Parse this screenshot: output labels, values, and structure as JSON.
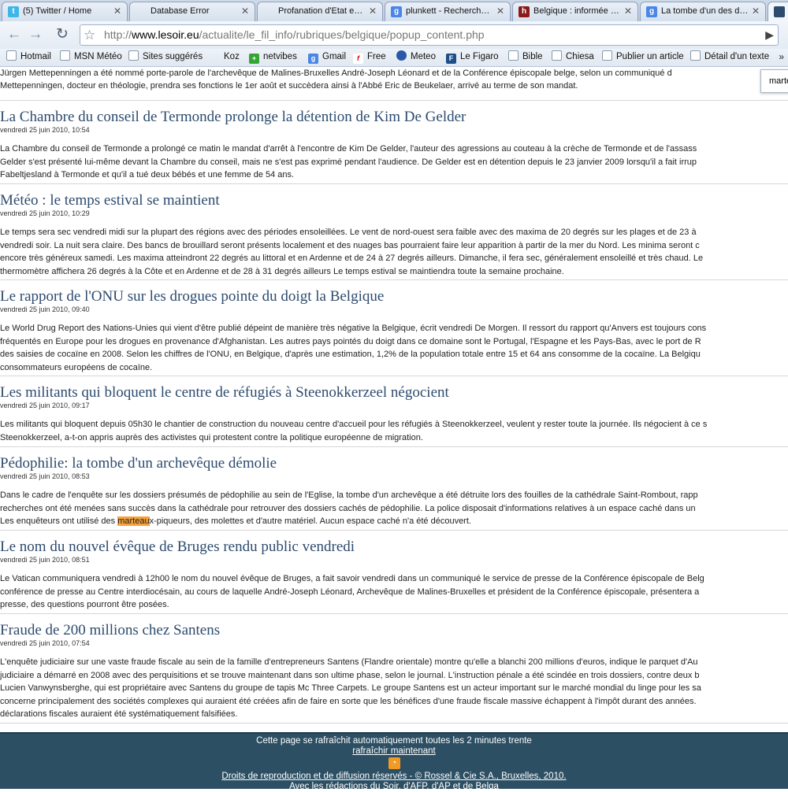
{
  "browser": {
    "tabs": [
      {
        "label": "(5) Twitter / Home",
        "icon": "twitter-icon"
      },
      {
        "label": "Database Error",
        "icon": "page-icon"
      },
      {
        "label": "Profanation d'Etat e…",
        "icon": "page-icon"
      },
      {
        "label": "plunkett - Recherch…",
        "icon": "google-icon"
      },
      {
        "label": "Belgique : informée …",
        "icon": "site-icon"
      },
      {
        "label": "La tombe d'un des d…",
        "icon": "google-icon"
      }
    ],
    "url_prefix": "http://",
    "url_domain": "www.lesoir.eu",
    "url_path": "/actualite/le_fil_info/rubriques/belgique/popup_content.php",
    "bookmarks": [
      {
        "label": "Hotmail"
      },
      {
        "label": "MSN Météo"
      },
      {
        "label": "Sites suggérés"
      },
      {
        "label": "Koz"
      },
      {
        "label": "netvibes"
      },
      {
        "label": "Gmail"
      },
      {
        "label": "Free"
      },
      {
        "label": "Meteo"
      },
      {
        "label": "Le Figaro"
      },
      {
        "label": "Bible"
      },
      {
        "label": "Chiesa"
      },
      {
        "label": "Publier un article"
      },
      {
        "label": "Détail d'un texte"
      }
    ],
    "bookmarks_more": "»",
    "find_text": "marte"
  },
  "lead_text": [
    "Jürgen Mettepenningen a été nommé porte-parole de l'archevêque de Malines-Bruxelles André-Joseph Léonard et de la Conférence épiscopale belge, selon un communiqué d",
    "Mettepenningen, docteur en théologie, prendra ses fonctions le 1er août et succèdera ainsi à l'Abbé Eric de Beukelaer, arrivé au terme de son mandat."
  ],
  "articles": [
    {
      "title": "La Chambre du conseil de Termonde prolonge la détention de Kim De Gelder",
      "date": "vendredi 25 juin 2010, 10:54",
      "lines": [
        "La Chambre du conseil de Termonde a prolongé ce matin le mandat d'arrêt à l'encontre de Kim De Gelder, l'auteur des agressions au couteau à la crèche de Termonde et de l'assass",
        "Gelder s'est présenté lui-même devant la Chambre du conseil, mais ne s'est pas exprimé pendant l'audience. De Gelder est en détention depuis le 23 janvier 2009 lorsqu'il a fait irrup",
        "Fabeltjesland à Termonde et qu'il a tué deux bébés et une femme de 54 ans."
      ]
    },
    {
      "title": "Météo : le temps estival se maintient",
      "date": "vendredi 25 juin 2010, 10:29",
      "lines": [
        "Le temps sera sec vendredi midi sur la plupart des régions avec des périodes ensoleillées. Le vent de nord-ouest sera faible avec des maxima de 20 degrés sur les plages et de 23 à",
        "vendredi soir. La nuit sera claire. Des bancs de brouillard seront présents localement et des nuages bas pourraient faire leur apparition à partir de la mer du Nord. Les minima seront c",
        "encore très généreux samedi. Les maxima atteindront 22 degrés au littoral et en Ardenne et de 24 à 27 degrés ailleurs. Dimanche, il fera sec, généralement ensoleillé et très chaud. Le",
        "thermomètre affichera 26 degrés à la Côte et en Ardenne et de 28 à 31 degrés ailleurs Le temps estival se maintiendra toute la semaine prochaine."
      ]
    },
    {
      "title": "Le rapport de l'ONU sur les drogues pointe du doigt la Belgique",
      "date": "vendredi 25 juin 2010, 09:40",
      "lines": [
        "Le World Drug Report des Nations-Unies qui vient d'être publié dépeint de manière très négative la Belgique, écrit vendredi De Morgen. Il ressort du rapport qu'Anvers est toujours cons",
        "fréquentés en Europe pour les drogues en provenance d'Afghanistan. Les autres pays pointés du doigt dans ce domaine sont le Portugal, l'Espagne et les Pays-Bas, avec le port de R",
        "des saisies de cocaïne en 2008. Selon les chiffres de l'ONU, en Belgique, d'après une estimation, 1,2% de la population totale entre 15 et 64 ans consomme de la cocaïne. La Belgiqu",
        "consommateurs européens de cocaïne."
      ]
    },
    {
      "title": "Les militants qui bloquent le centre de réfugiés à Steenokkerzeel négocient",
      "date": "vendredi 25 juin 2010, 09:17",
      "lines": [
        "Les militants qui bloquent depuis 05h30 le chantier de construction du nouveau centre d'accueil pour les réfugiés à Steenokkerzeel, veulent y rester toute la journée. Ils négocient à ce s",
        "Steenokkerzeel, a-t-on appris auprès des activistes qui protestent contre la politique européenne de migration."
      ]
    },
    {
      "title": "Pédophilie: la tombe d'un archevêque démolie",
      "date": "vendredi 25 juin 2010, 08:53",
      "lines": [
        "Dans le cadre de l'enquête sur les dossiers présumés de pédophilie au sein de l'Eglise, la tombe d'un archevêque a été détruite lors des fouilles de la cathédrale Saint-Rombout, rapp",
        "recherches ont été menées sans succès dans la cathédrale pour retrouver des dossiers cachés de pédophilie. La police disposait d'informations relatives à un espace caché dans un"
      ],
      "hl_line": {
        "before": "Les enquêteurs ont utilisé des ",
        "match": "marteau",
        "after": "x-piqueurs, des molettes et d'autre matériel. Aucun espace caché n'a été découvert."
      }
    },
    {
      "title": "Le nom du nouvel évêque de Bruges rendu public vendredi",
      "date": "vendredi 25 juin 2010, 08:51",
      "lines": [
        "Le Vatican communiquera vendredi à 12h00 le nom du nouvel évêque de Bruges, a fait savoir vendredi dans un communiqué le service de presse de la Conférence épiscopale de Belg",
        "conférence de presse au Centre interdiocésain, au cours de laquelle André-Joseph Léonard, Archevêque de Malines-Bruxelles et président de la Conférence épiscopale, présentera a",
        "presse, des questions pourront être posées."
      ]
    },
    {
      "title": "Fraude de 200 millions chez Santens",
      "date": "vendredi 25 juin 2010, 07:54",
      "lines": [
        "L'enquête judiciaire sur une vaste fraude fiscale au sein de la famille d'entrepreneurs Santens (Flandre orientale) montre qu'elle a blanchi 200 millions d'euros, indique le parquet d'Au",
        "judiciaire a démarré en 2008 avec des perquisitions et se trouve maintenant dans son ultime phase, selon le journal. L'instruction pénale a été scindée en trois dossiers, contre deux b",
        "Lucien Vanwynsberghe, qui est propriétaire avec Santens du groupe de tapis Mc Three Carpets. Le groupe Santens est un acteur important sur le marché mondial du linge pour les sa",
        "concerne principalement des sociétés complexes qui auraient été créées afin de faire en sorte que les bénéfices d'une fraude fiscale massive échappent à l'impôt durant des années.",
        "déclarations fiscales auraient été systématiquement falsifiées."
      ]
    }
  ],
  "footer": {
    "refresh_note": "Cette page se rafraîchit automatiquement toutes les 2 minutes trente",
    "refresh_link": "rafraîchir maintenant",
    "rights": "Droits de reproduction et de diffusion réservés - © Rossel & Cie S.A., Bruxelles, 2010.",
    "newsrooms": "Avec les rédactions du Soir, d'AFP, d'AP et de Belga"
  }
}
